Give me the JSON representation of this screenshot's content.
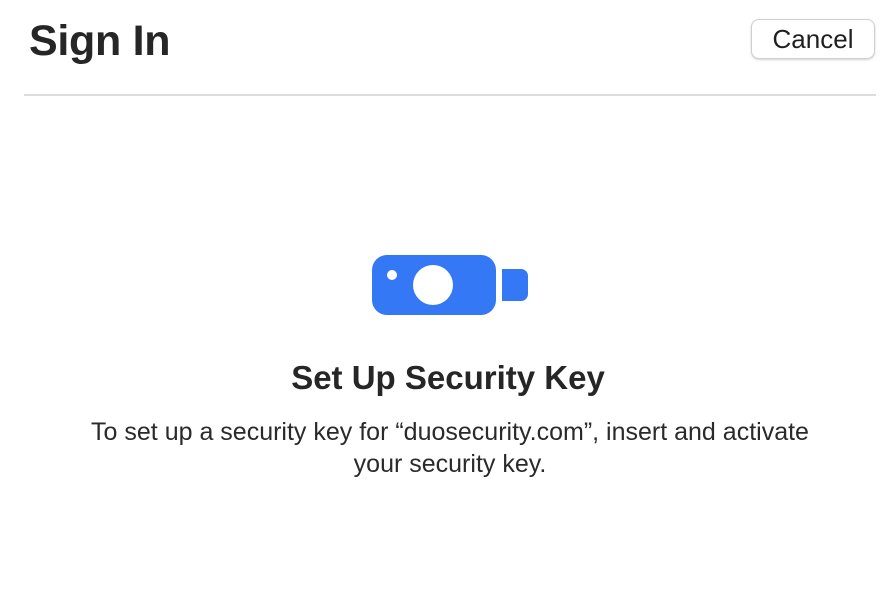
{
  "header": {
    "title": "Sign In",
    "cancel_label": "Cancel"
  },
  "main": {
    "icon": "security-key-icon",
    "heading": "Set Up Security Key",
    "description": "To set up a security key for “duosecurity.com”, insert and activate your security key."
  },
  "colors": {
    "accent": "#3478f6",
    "divider": "#dcdcdc",
    "text": "#262626"
  }
}
